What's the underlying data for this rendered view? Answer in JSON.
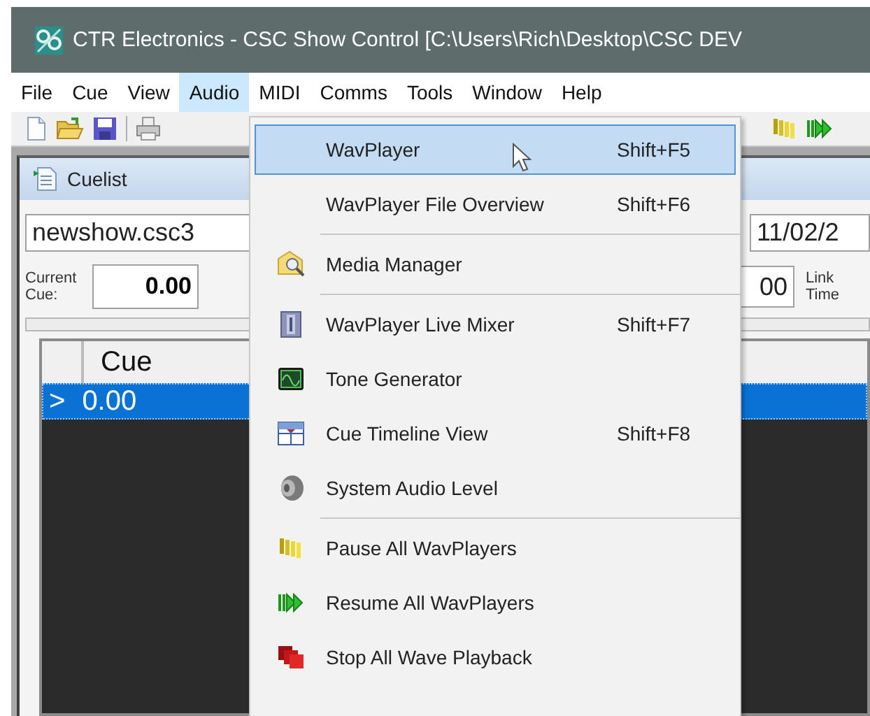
{
  "window": {
    "title": "CTR Electronics - CSC Show Control [C:\\Users\\Rich\\Desktop\\CSC DEV"
  },
  "menu_bar": [
    {
      "label": "File",
      "selected": false
    },
    {
      "label": "Cue",
      "selected": false
    },
    {
      "label": "View",
      "selected": false
    },
    {
      "label": "Audio",
      "selected": true
    },
    {
      "label": "MIDI",
      "selected": false
    },
    {
      "label": "Comms",
      "selected": false
    },
    {
      "label": "Tools",
      "selected": false
    },
    {
      "label": "Window",
      "selected": false
    },
    {
      "label": "Help",
      "selected": false
    }
  ],
  "cuelist": {
    "title": "Cuelist",
    "file_name": "newshow.csc3",
    "date": "11/02/2",
    "current_cue_label": "Current Cue:",
    "current_cue": "0.00",
    "field_2": "00",
    "link_time_label": "Link Time",
    "table": {
      "columns": [
        "Cue"
      ],
      "rows": [
        {
          "marker": ">",
          "cue": "0.00",
          "selected": true
        }
      ]
    }
  },
  "audio_menu": [
    {
      "kind": "item",
      "label": "WavPlayer",
      "shortcut": "Shift+F5",
      "selected": true
    },
    {
      "kind": "item",
      "label": "WavPlayer File Overview",
      "shortcut": "Shift+F6",
      "selected": false
    },
    {
      "kind": "separator"
    },
    {
      "kind": "item",
      "label": "Media Manager",
      "selected": false
    },
    {
      "kind": "separator"
    },
    {
      "kind": "item",
      "label": "WavPlayer Live Mixer",
      "shortcut": "Shift+F7",
      "selected": false
    },
    {
      "kind": "item",
      "label": "Tone Generator",
      "selected": false
    },
    {
      "kind": "item",
      "label": "Cue Timeline View",
      "shortcut": "Shift+F8",
      "selected": false
    },
    {
      "kind": "item",
      "label": "System Audio Level",
      "selected": false
    },
    {
      "kind": "separator"
    },
    {
      "kind": "item",
      "label": "Pause All WavPlayers",
      "selected": false
    },
    {
      "kind": "item",
      "label": "Resume All WavPlayers",
      "selected": false
    },
    {
      "kind": "item",
      "label": "Stop All Wave Playback",
      "selected": false
    }
  ]
}
